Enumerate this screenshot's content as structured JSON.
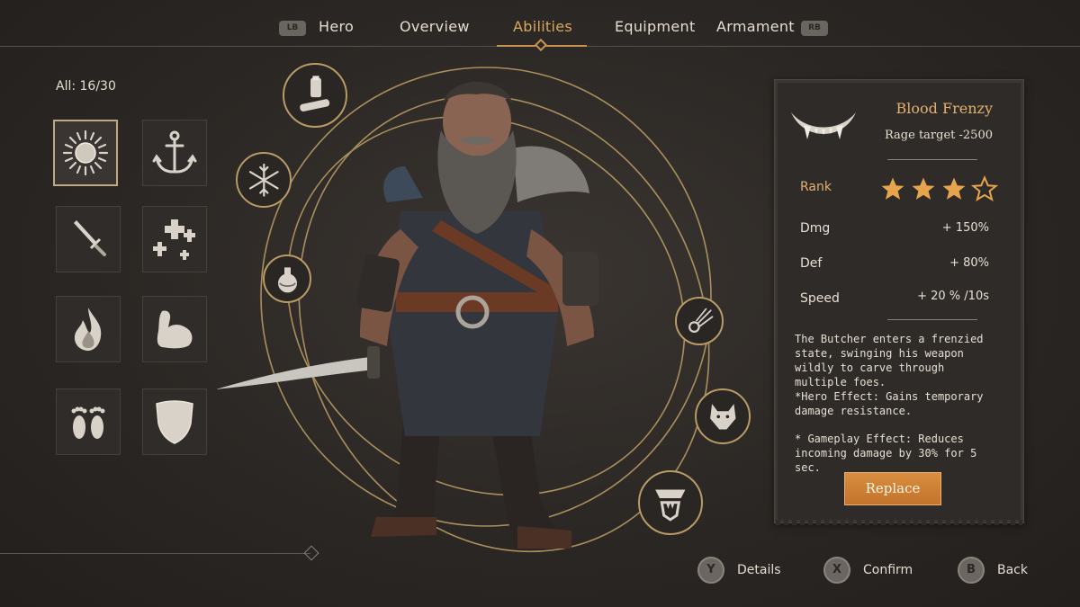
{
  "nav": {
    "lb": "LB",
    "rb": "RB",
    "tabs": [
      "Hero",
      "Overview",
      "Abilities",
      "Equipment",
      "Armament"
    ],
    "active_tab": "Abilities"
  },
  "abilities": {
    "count_label": "All: 16/30",
    "slots": [
      {
        "icon": "sun-icon"
      },
      {
        "icon": "anchor-icon"
      },
      {
        "icon": "dagger-icon"
      },
      {
        "icon": "heal-crosses-icon"
      },
      {
        "icon": "flame-icon"
      },
      {
        "icon": "flexed-arm-icon"
      },
      {
        "icon": "footprints-icon"
      },
      {
        "icon": "shield-icon"
      }
    ]
  },
  "orbit_icons": [
    "potion-bottle-icon",
    "snowflake-icon",
    "flask-icon",
    "comet-icon",
    "wolf-head-icon",
    "beast-jaw-icon"
  ],
  "detail": {
    "name": "Blood Frenzy",
    "subtitle": "Rage target -2500",
    "icon": "fangs-icon",
    "rank_label": "Rank",
    "rank": 3,
    "rank_max": 4,
    "stats": [
      {
        "label": "Dmg",
        "value": "+ 150%"
      },
      {
        "label": "Def",
        "value": "+ 80%"
      },
      {
        "label": "Speed",
        "value": "+ 20 % /10s"
      }
    ],
    "description": "The Butcher enters a frenzied state, swinging his weapon wildly to carve through multiple foes.",
    "hero_effect": "*Hero Effect: Gains temporary damage resistance.",
    "gameplay_effect": "* Gameplay Effect: Reduces incoming damage by 30% for 5 sec.",
    "replace_label": "Replace"
  },
  "hints": [
    {
      "button": "Y",
      "label": "Details"
    },
    {
      "button": "X",
      "label": "Confirm"
    },
    {
      "button": "B",
      "label": "Back"
    }
  ],
  "colors": {
    "accent": "#c9944f",
    "title": "#e2b170",
    "button": "#d08538",
    "panel": "#2f2b28"
  }
}
